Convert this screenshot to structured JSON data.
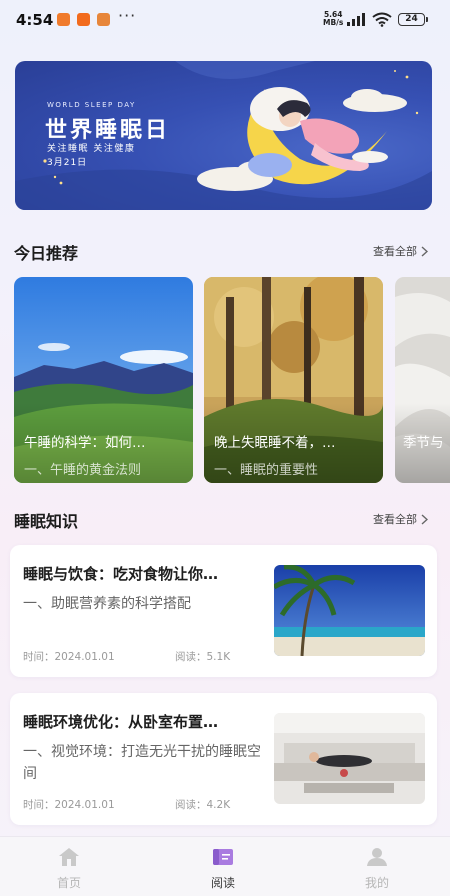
{
  "status_bar": {
    "time": "4:54",
    "net_speed": "5.64",
    "net_unit": "MB/s",
    "battery": "24",
    "more_icon": "more-dots-icon"
  },
  "banner": {
    "small_text": "WORLD SLEEP DAY",
    "title": "世界睡眠日",
    "subtitle": "关注睡眠 关注健康",
    "date": "3月21日"
  },
  "recommend": {
    "title": "今日推荐",
    "see_all": "查看全部",
    "cards": [
      {
        "title": "午睡的科学：如何…",
        "subtitle": "一、午睡的黄金法则"
      },
      {
        "title": "晚上失眠睡不着，…",
        "subtitle": "一、睡眠的重要性"
      },
      {
        "title": "季节与",
        "subtitle": ""
      }
    ]
  },
  "knowledge": {
    "title": "睡眠知识",
    "see_all": "查看全部",
    "items": [
      {
        "title": "睡眠与饮食：吃对食物让你…",
        "subtitle": "一、助眠营养素的科学搭配",
        "time_label": "时间：",
        "time": "2024.01.01",
        "read_label": "阅读：",
        "reads": "5.1K"
      },
      {
        "title": "睡眠环境优化：从卧室布置…",
        "subtitle": "一、视觉环境：打造无光干扰的睡眠空间",
        "time_label": "时间：",
        "time": "2024.01.01",
        "read_label": "阅读：",
        "reads": "4.2K"
      }
    ]
  },
  "tabs": [
    {
      "label": "首页",
      "icon": "home-icon",
      "active": false
    },
    {
      "label": "阅读",
      "icon": "book-icon",
      "active": true
    },
    {
      "label": "我的",
      "icon": "profile-icon",
      "active": false
    }
  ],
  "colors": {
    "banner_blue": "#3650b3",
    "active_tab_icon": "#9b6bd8",
    "inactive_tab": "#b6b6b6"
  }
}
